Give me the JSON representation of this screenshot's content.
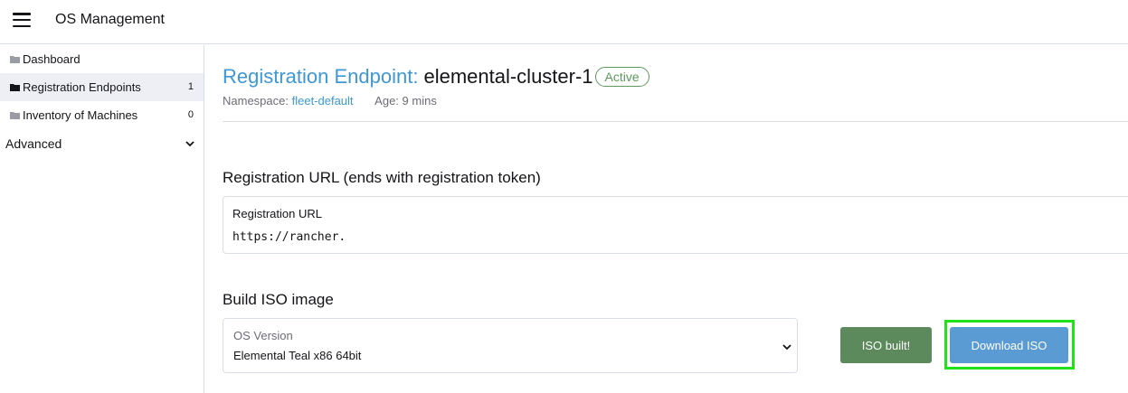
{
  "header": {
    "app_title": "OS Management"
  },
  "sidebar": {
    "items": [
      {
        "label": "Dashboard",
        "icon": "folder-icon",
        "count": ""
      },
      {
        "label": "Registration Endpoints",
        "icon": "folder-icon",
        "count": "1"
      },
      {
        "label": "Inventory of Machines",
        "icon": "folder-icon",
        "count": "0"
      }
    ],
    "advanced_label": "Advanced"
  },
  "page": {
    "type_label": "Registration Endpoint:",
    "name": "elemental-cluster-1",
    "status": "Active",
    "namespace_label": "Namespace:",
    "namespace_value": "fleet-default",
    "age_label": "Age:",
    "age_value": "9 mins"
  },
  "registration": {
    "section_title": "Registration URL (ends with registration token)",
    "field_label": "Registration URL",
    "field_value": "https://rancher."
  },
  "build_iso": {
    "section_title": "Build ISO image",
    "os_version_label": "OS Version",
    "os_version_value": "Elemental Teal x86 64bit",
    "iso_built_label": "ISO built!",
    "download_label": "Download ISO"
  },
  "colors": {
    "link_blue": "#3d98d3",
    "active_green": "#5d995d",
    "built_button": "#5d8a5d",
    "download_button": "#5a9bd4",
    "highlight": "#21e01c"
  }
}
